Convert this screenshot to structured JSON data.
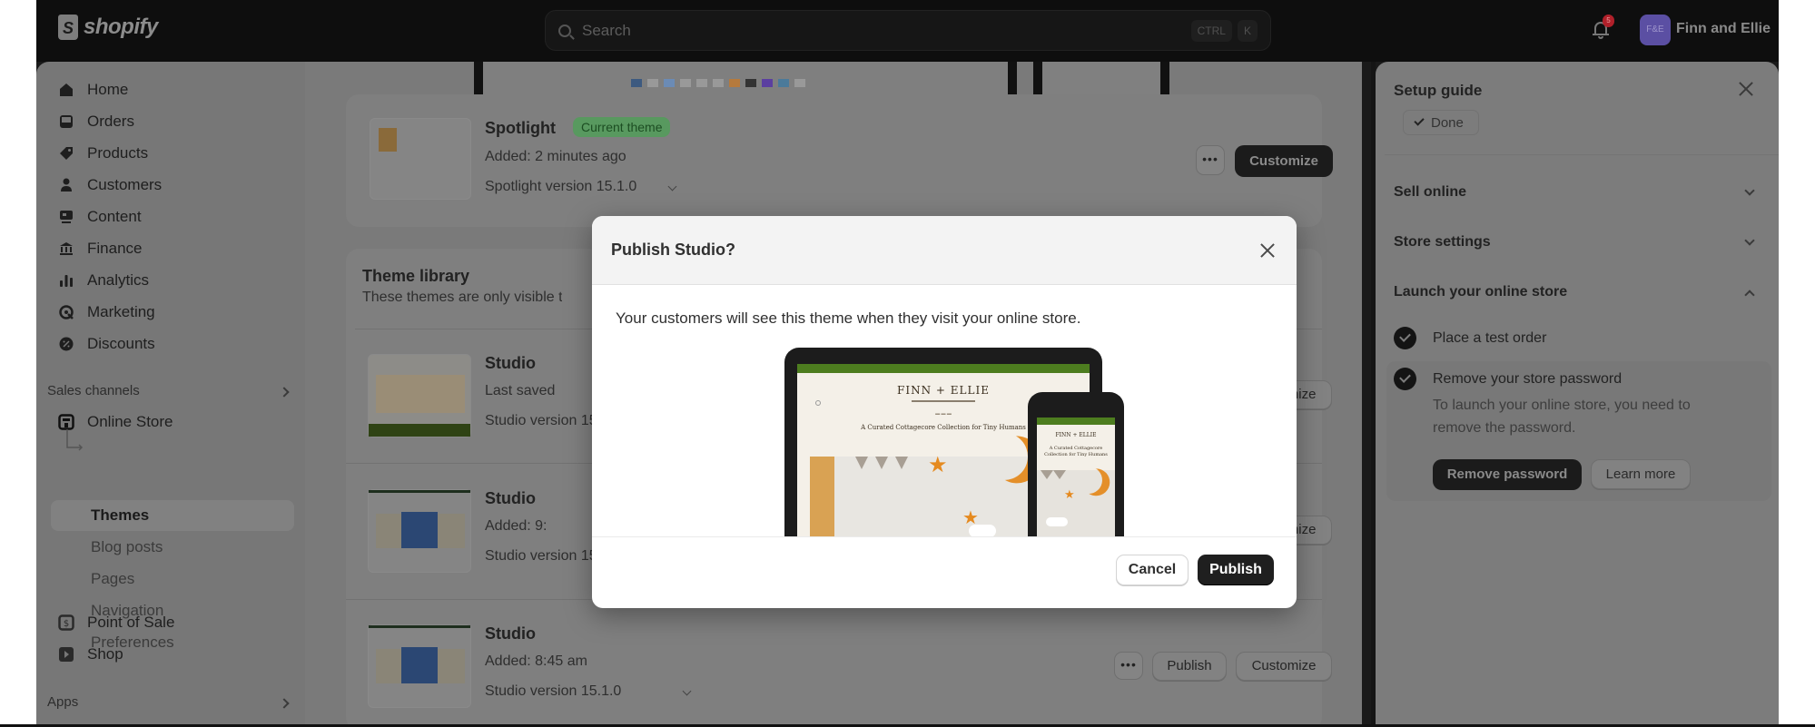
{
  "topbar": {
    "logo_text": "shopify",
    "search_placeholder": "Search",
    "shortcut_keys": [
      "CTRL",
      "K"
    ],
    "notification_count": "5",
    "avatar_initials": "F&E",
    "store_name": "Finn and Ellie"
  },
  "sidebar": {
    "items": [
      {
        "label": "Home",
        "icon": "home-icon"
      },
      {
        "label": "Orders",
        "icon": "orders-inbox-icon"
      },
      {
        "label": "Products",
        "icon": "tag-icon"
      },
      {
        "label": "Customers",
        "icon": "person-icon"
      },
      {
        "label": "Content",
        "icon": "image-content-icon"
      },
      {
        "label": "Finance",
        "icon": "bank-icon"
      },
      {
        "label": "Analytics",
        "icon": "bar-chart-icon"
      },
      {
        "label": "Marketing",
        "icon": "target-icon"
      },
      {
        "label": "Discounts",
        "icon": "discount-badge-icon"
      }
    ],
    "sales_channels_label": "Sales channels",
    "online_store_label": "Online Store",
    "online_store_subitems": [
      {
        "label": "Themes",
        "active": true
      },
      {
        "label": "Blog posts",
        "active": false
      },
      {
        "label": "Pages",
        "active": false
      },
      {
        "label": "Navigation",
        "active": false
      },
      {
        "label": "Preferences",
        "active": false
      }
    ],
    "channels": [
      {
        "label": "Point of Sale",
        "icon": "point-of-sale-icon"
      },
      {
        "label": "Shop",
        "icon": "shop-play-icon"
      }
    ],
    "apps_label": "Apps"
  },
  "main": {
    "current_theme": {
      "name": "Spotlight",
      "badge": "Current theme",
      "added": "Added: 2 minutes ago",
      "version": "Spotlight version 15.1.0",
      "customize_label": "Customize",
      "more_label": "•••"
    },
    "library": {
      "title": "Theme library",
      "subtitle": "These themes are only visible to you.",
      "themes": [
        {
          "name": "Studio",
          "meta": "Last saved",
          "version": "Studio version 15.1.0",
          "customize_label": "Customize"
        },
        {
          "name": "Studio",
          "meta": "Added: 9:",
          "version": "Studio version 15.1.0",
          "customize_label": "Customize"
        },
        {
          "name": "Studio",
          "meta": "Added: 8:45 am",
          "version": "Studio version 15.1.0",
          "publish_label": "Publish",
          "customize_label": "Customize",
          "more_label": "•••"
        }
      ]
    }
  },
  "setup_guide": {
    "title": "Setup guide",
    "done_label": "Done",
    "sections": [
      {
        "label": "Sell online",
        "expanded": false
      },
      {
        "label": "Store settings",
        "expanded": false
      },
      {
        "label": "Launch your online store",
        "expanded": true
      }
    ],
    "tasks": [
      {
        "label": "Place a test order",
        "completed": true
      },
      {
        "label": "Remove your store password",
        "completed": true,
        "description": "To launch your online store, you need to remove the password.",
        "primary_action": "Remove password",
        "secondary_action": "Learn more"
      }
    ]
  },
  "modal": {
    "title": "Publish Studio?",
    "body": "Your customers will see this theme when they visit your online store.",
    "cancel_label": "Cancel",
    "publish_label": "Publish",
    "preview": {
      "brand": "FINN + ELLIE",
      "headline": "A Curated Cottagecore Collection for Tiny Humans",
      "mobile_headline": "A Curated Cottagecore Collection for Tiny Humans"
    }
  },
  "colors": {
    "topbar_bg": "#0e0e0e",
    "badge_green": "#58995f",
    "primary_button": "#1f1f1f",
    "notification_red": "#b0202a",
    "avatar_purple": "#5b4fa3",
    "theme_banner_green": "#4d7d1f"
  }
}
